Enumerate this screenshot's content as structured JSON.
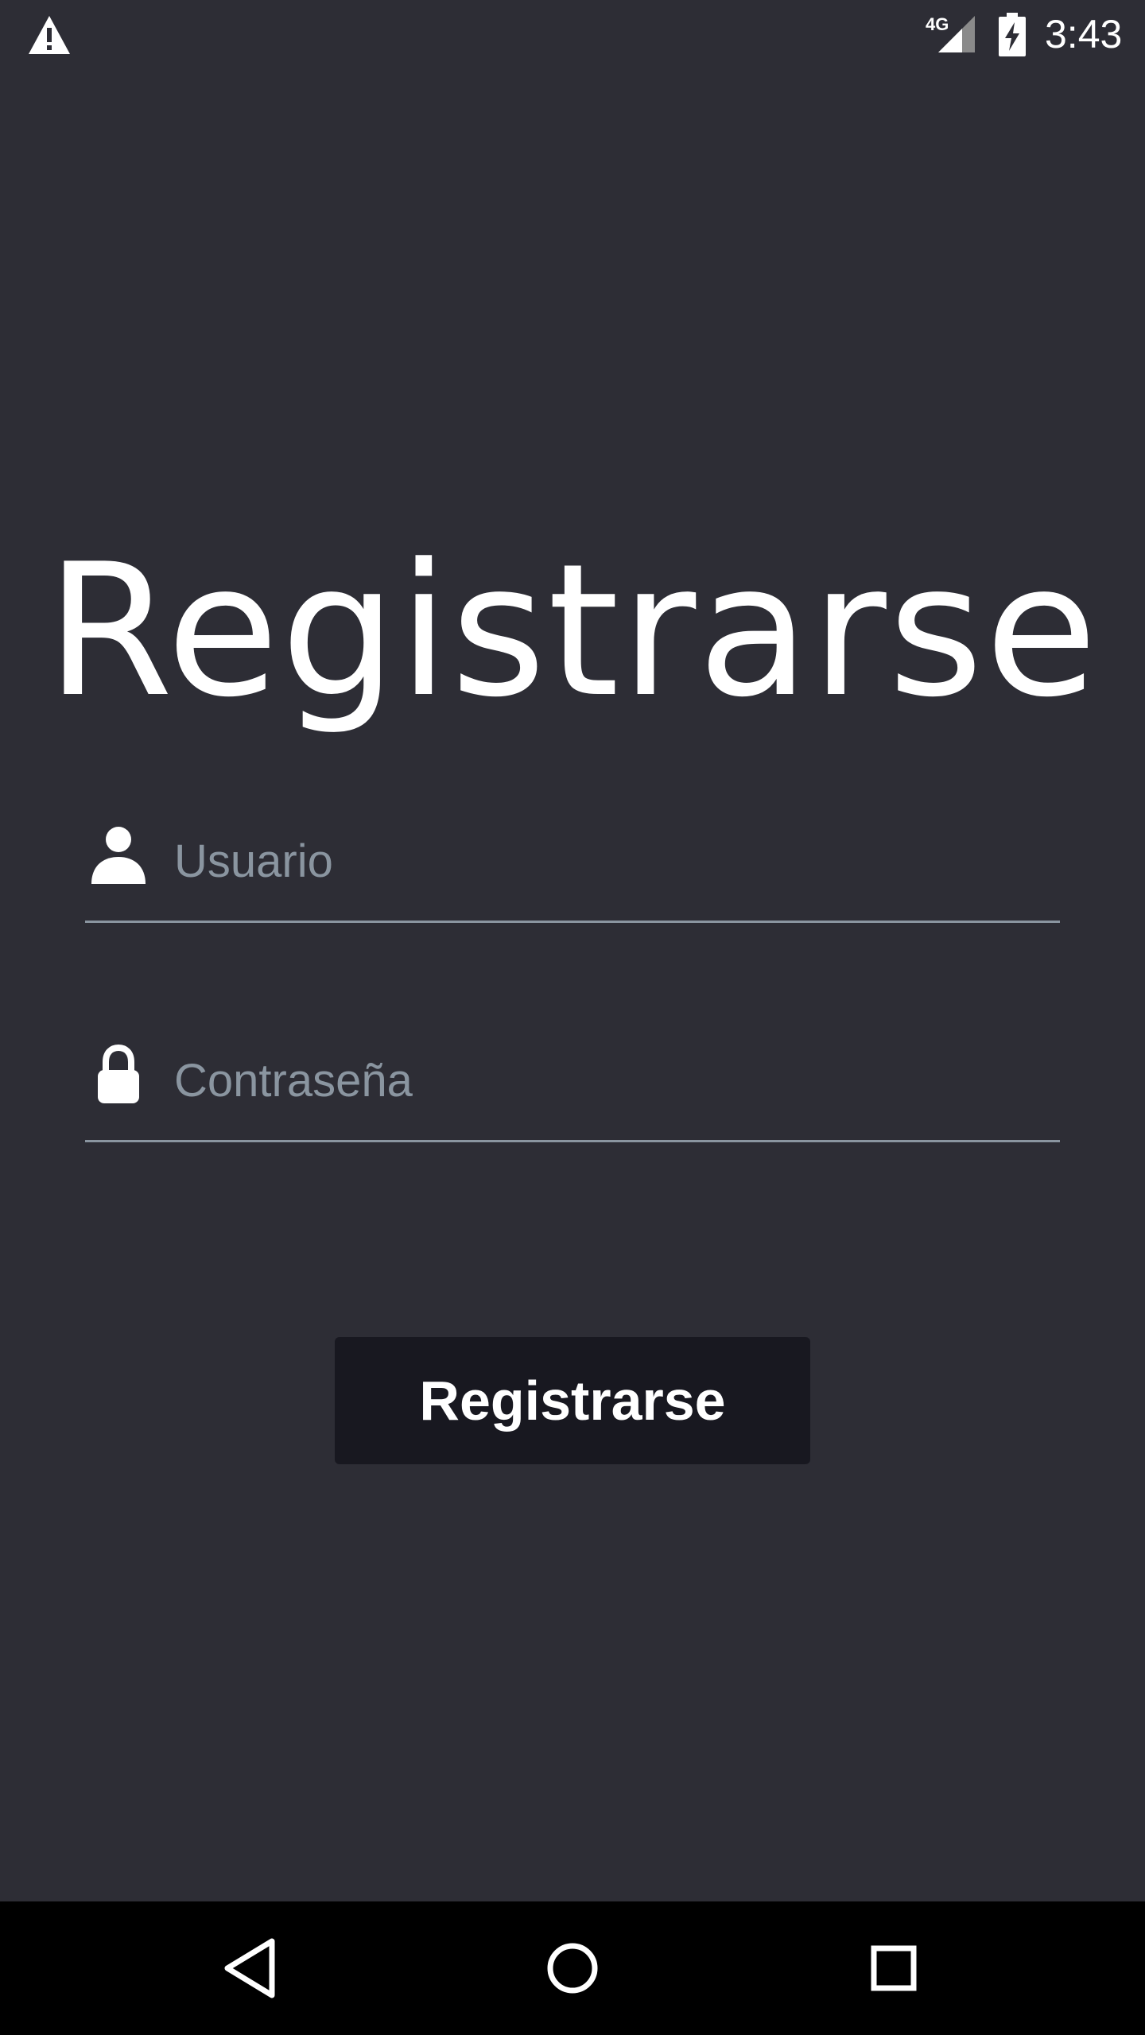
{
  "status_bar": {
    "network": "4G",
    "time": "3:43",
    "icons": [
      "warning-icon",
      "signal-icon",
      "battery-charging-icon"
    ]
  },
  "title": "Registrarse",
  "form": {
    "username": {
      "placeholder": "Usuario",
      "value": "",
      "icon": "person-icon"
    },
    "password": {
      "placeholder": "Contraseña",
      "value": "",
      "icon": "lock-icon"
    },
    "submit_label": "Registrarse"
  },
  "nav_bar": {
    "buttons": [
      "back-icon",
      "home-icon",
      "recents-icon"
    ]
  },
  "colors": {
    "background": "#2d2d35",
    "button": "#181820",
    "underline": "#8a95a0",
    "placeholder": "#8a95a0",
    "text": "#ffffff"
  }
}
